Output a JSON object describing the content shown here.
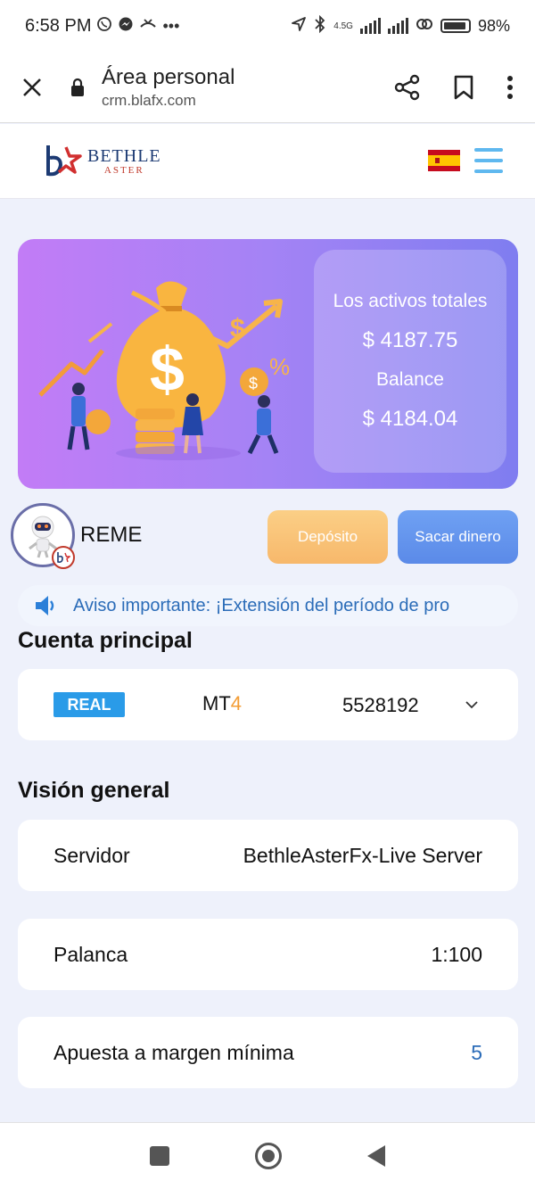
{
  "status_bar": {
    "time": "6:58 PM",
    "network": "4.5G",
    "battery": "98%",
    "dots": "•••"
  },
  "browser": {
    "title": "Área personal",
    "url": "crm.blafx.com"
  },
  "site": {
    "logo_main": "BETHLE",
    "logo_sub": "ASTER"
  },
  "banner": {
    "total_assets_label": "Los activos totales",
    "total_assets_value": "$ 4187.75",
    "balance_label": "Balance",
    "balance_value": "$ 4184.04"
  },
  "user": {
    "name": "REME",
    "deposit_label": "Depósito",
    "withdraw_label": "Sacar dinero"
  },
  "notice": {
    "text": "Aviso importante: ¡Extensión del período de pro"
  },
  "main_account": {
    "title": "Cuenta principal",
    "type": "REAL",
    "platform_prefix": "MT",
    "platform_number": "4",
    "number": "5528192"
  },
  "overview": {
    "title": "Visión general",
    "rows": [
      {
        "label": "Servidor",
        "value": "BethleAsterFx-Live Server"
      },
      {
        "label": "Palanca",
        "value": "1:100"
      },
      {
        "label": "Apuesta a margen mínima",
        "value": "5"
      }
    ]
  },
  "colors": {
    "accent_blue": "#2a9be8",
    "deposit_orange": "#f7b86b",
    "withdraw_blue": "#5b8ae8",
    "banner_purple": "#a483f5"
  }
}
